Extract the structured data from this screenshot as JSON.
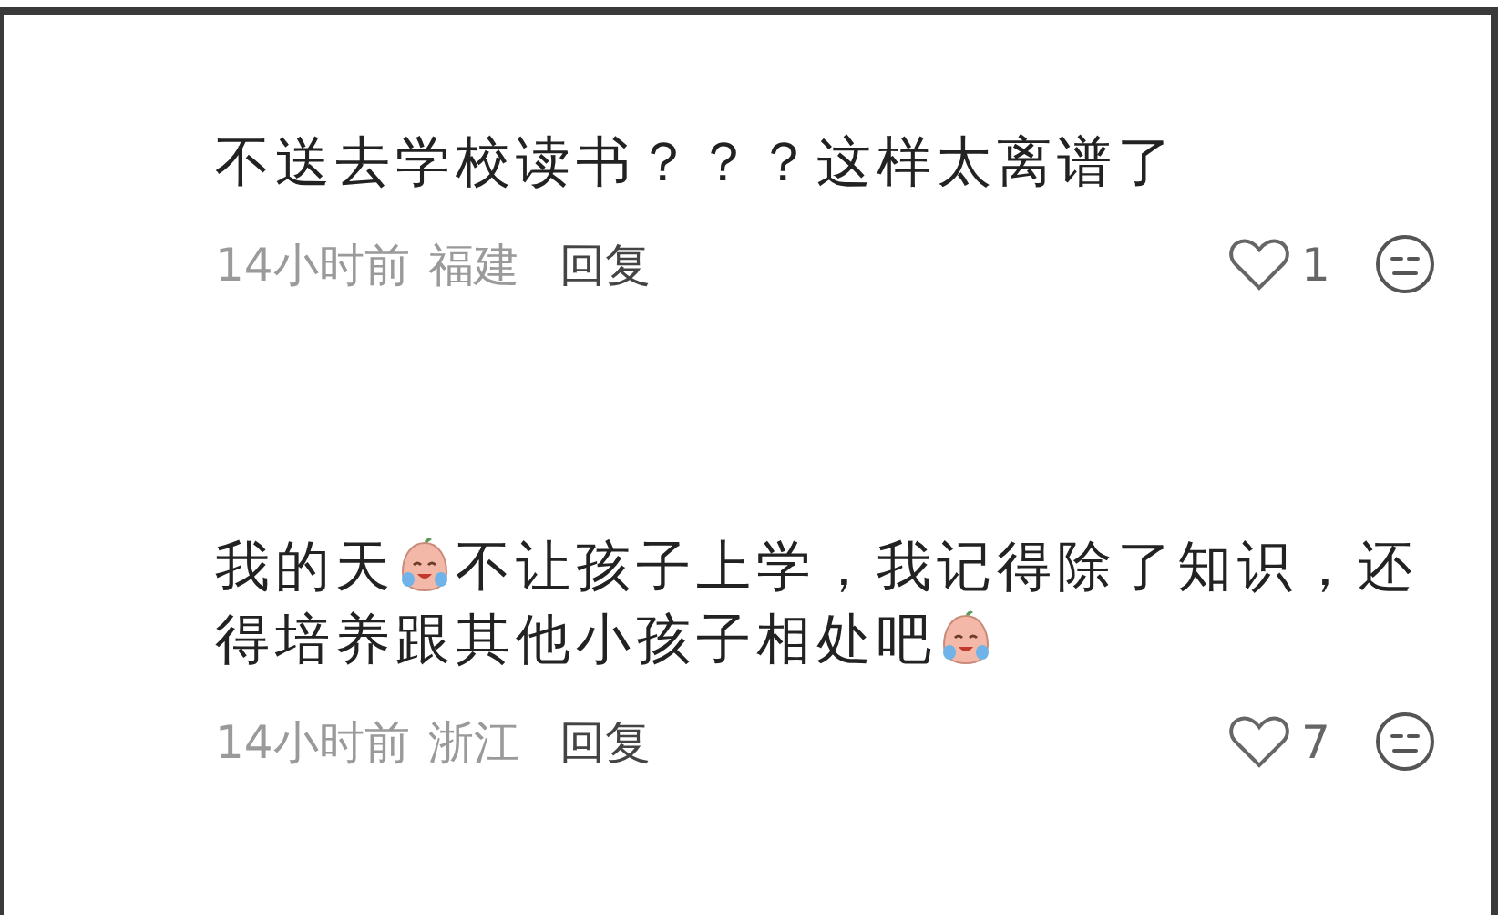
{
  "comments": [
    {
      "body": [
        {
          "kind": "text",
          "text": "不送去学校读书？？？这样太离谱了"
        }
      ],
      "time": "14小时前",
      "location": "福建",
      "reply": "回复",
      "likes": "1"
    },
    {
      "body": [
        {
          "kind": "text",
          "text": "我的天"
        },
        {
          "kind": "emoji"
        },
        {
          "kind": "text",
          "text": "不让孩子上学，我记得除了知识，还"
        },
        {
          "kind": "text",
          "text": "得培养跟其他小孩子相处吧"
        },
        {
          "kind": "emoji"
        }
      ],
      "time": "14小时前",
      "location": "浙江",
      "reply": "回复",
      "likes": "7"
    }
  ]
}
